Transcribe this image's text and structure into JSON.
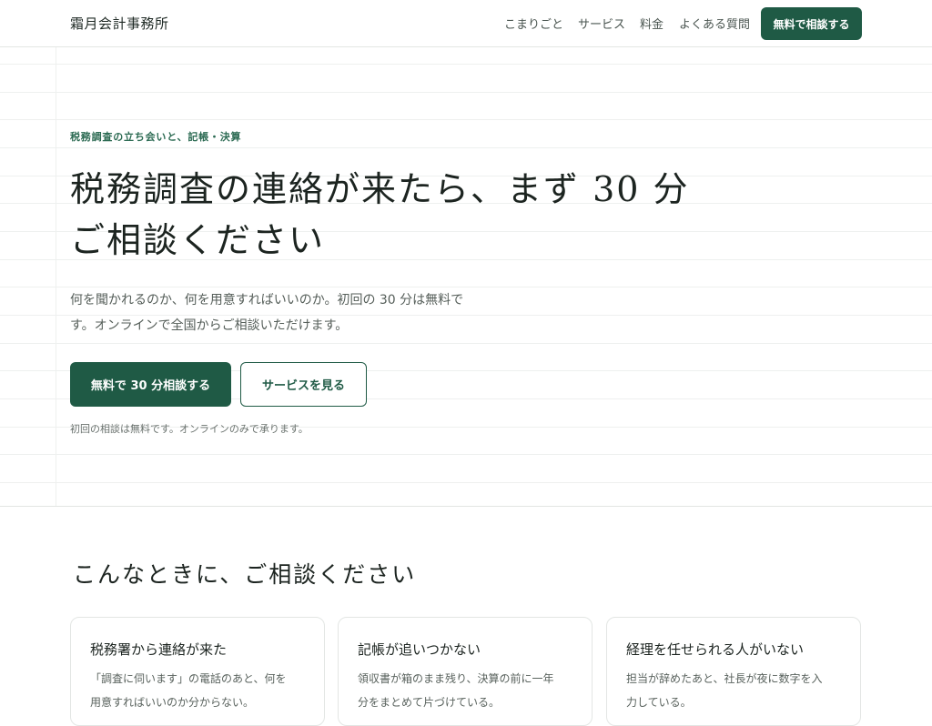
{
  "header": {
    "logo": "霜月会計事務所",
    "nav": [
      "こまりごと",
      "サービス",
      "料金",
      "よくある質問"
    ],
    "cta": "無料で相談する"
  },
  "hero": {
    "eyebrow": "税務調査の立ち会いと、記帳・決算",
    "title_line1": "税務調査の連絡が来たら、まず 30 分",
    "title_line2": "ご相談ください",
    "desc_line1": "何を聞かれるのか、何を用意すればいいのか。初回の 30 分は無料で",
    "desc_line2": "す。オンラインで全国からご相談いただけます。",
    "primary_button": "無料で 30 分相談する",
    "secondary_button": "サービスを見る",
    "note": "初回の相談は無料です。オンラインのみで承ります。"
  },
  "problems": {
    "title": "こんなときに、ご相談ください",
    "cards": [
      {
        "title": "税務署から連絡が来た",
        "text_line1": "「調査に伺います」の電話のあと、何を",
        "text_line2": "用意すればいいのか分からない。"
      },
      {
        "title": "記帳が追いつかない",
        "text_line1": "領収書が箱のまま残り、決算の前に一年",
        "text_line2": "分をまとめて片づけている。"
      },
      {
        "title": "経理を任せられる人がいない",
        "text_line1": "担当が辞めたあと、社長が夜に数字を入",
        "text_line2": "力している。"
      }
    ]
  }
}
